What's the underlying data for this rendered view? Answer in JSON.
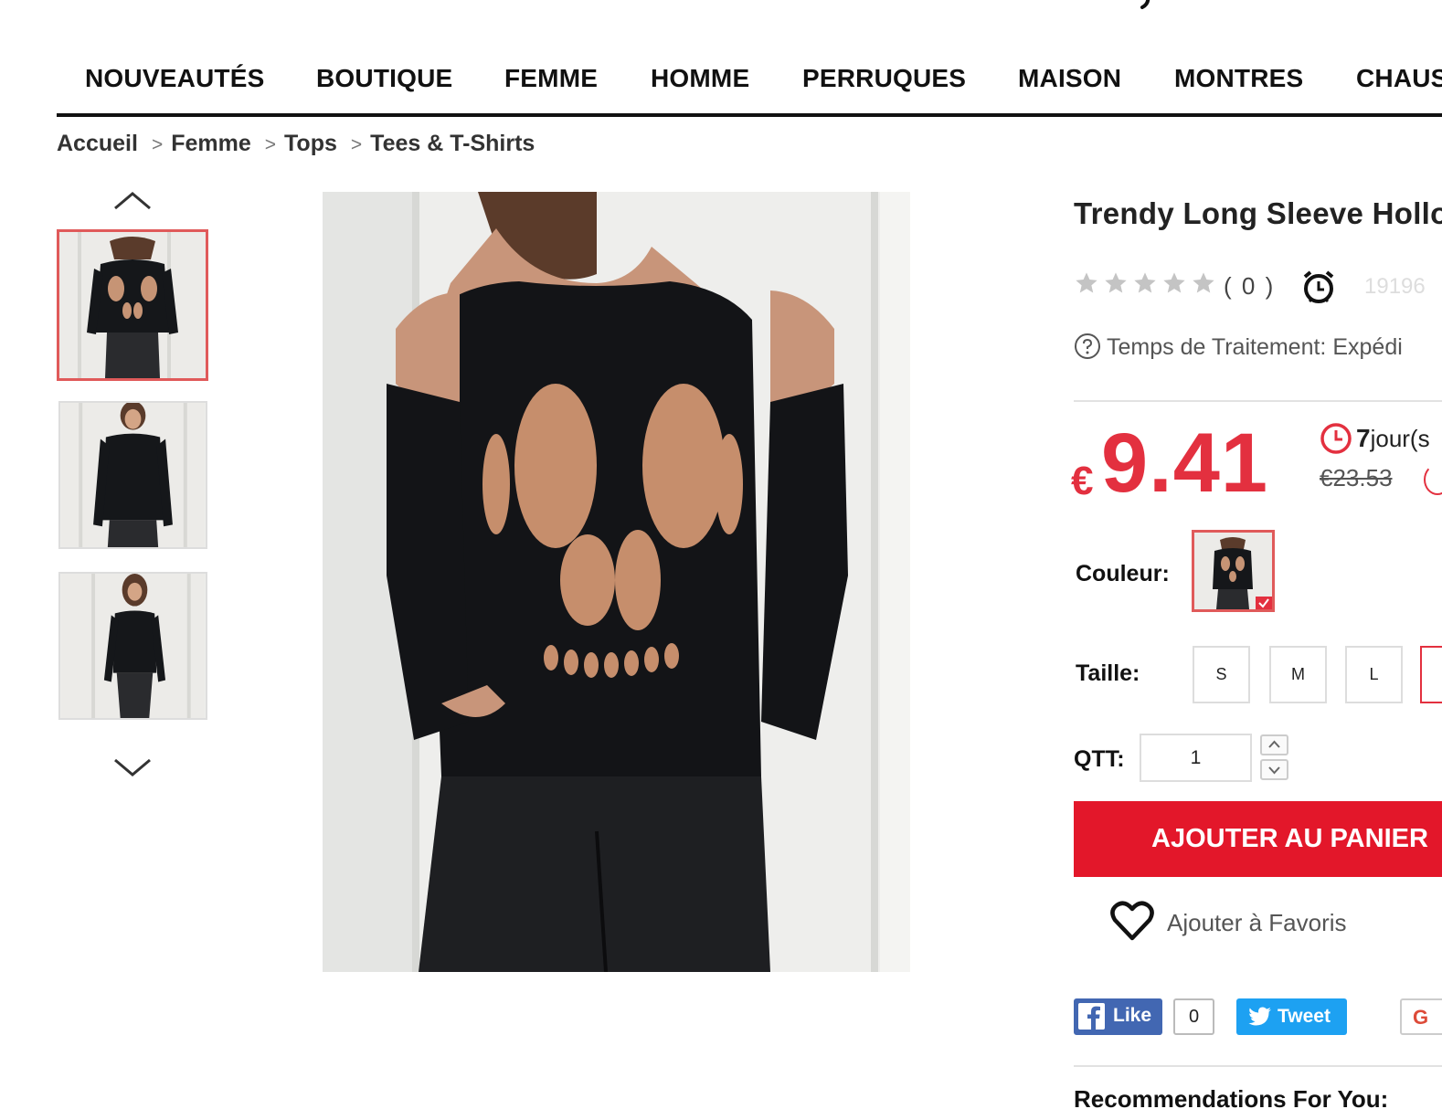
{
  "nav": {
    "items": [
      {
        "label": "NOUVEAUTÉS"
      },
      {
        "label": "BOUTIQUE"
      },
      {
        "label": "FEMME"
      },
      {
        "label": "HOMME"
      },
      {
        "label": "PERRUQUES"
      },
      {
        "label": "MAISON"
      },
      {
        "label": "MONTRES"
      },
      {
        "label": "CHAUS"
      }
    ]
  },
  "breadcrumb": {
    "items": [
      "Accueil",
      "Femme",
      "Tops",
      "Tees & T-Shirts"
    ],
    "separator": ">"
  },
  "gallery": {
    "thumbnails": [
      {
        "name": "thumbnail-back-view",
        "active": true
      },
      {
        "name": "thumbnail-front-view",
        "active": false
      },
      {
        "name": "thumbnail-full-front-view",
        "active": false
      }
    ],
    "up_icon": "chevron-up-icon",
    "down_icon": "chevron-down-icon"
  },
  "product": {
    "title": "Trendy Long Sleeve Hollo",
    "rating": {
      "stars": 0,
      "max": 5,
      "count_text": "( 0 )"
    },
    "item_code": "19196",
    "processing": {
      "label": "Temps de Traitement:",
      "value": "Expédi"
    },
    "price": {
      "currency": "€",
      "current": "9.41",
      "old": "€23.53",
      "countdown_days": "7",
      "countdown_unit": "jour(s"
    },
    "color": {
      "label": "Couleur:",
      "selected": "black"
    },
    "size": {
      "label": "Taille:",
      "options": [
        "S",
        "M",
        "L",
        ""
      ]
    },
    "quantity": {
      "label": "QTT:",
      "value": "1"
    },
    "add_to_cart": "AJOUTER AU PANIER",
    "favorites": "Ajouter à Favoris"
  },
  "social": {
    "fb_like": "Like",
    "fb_count": "0",
    "tweet": "Tweet",
    "gplus": "G"
  },
  "recommendations": {
    "heading": "Recommendations For You:"
  },
  "colors": {
    "accent_red": "#e3303f",
    "cart_button": "#e3172a",
    "facebook": "#4267b2",
    "twitter": "#1da1f2"
  }
}
